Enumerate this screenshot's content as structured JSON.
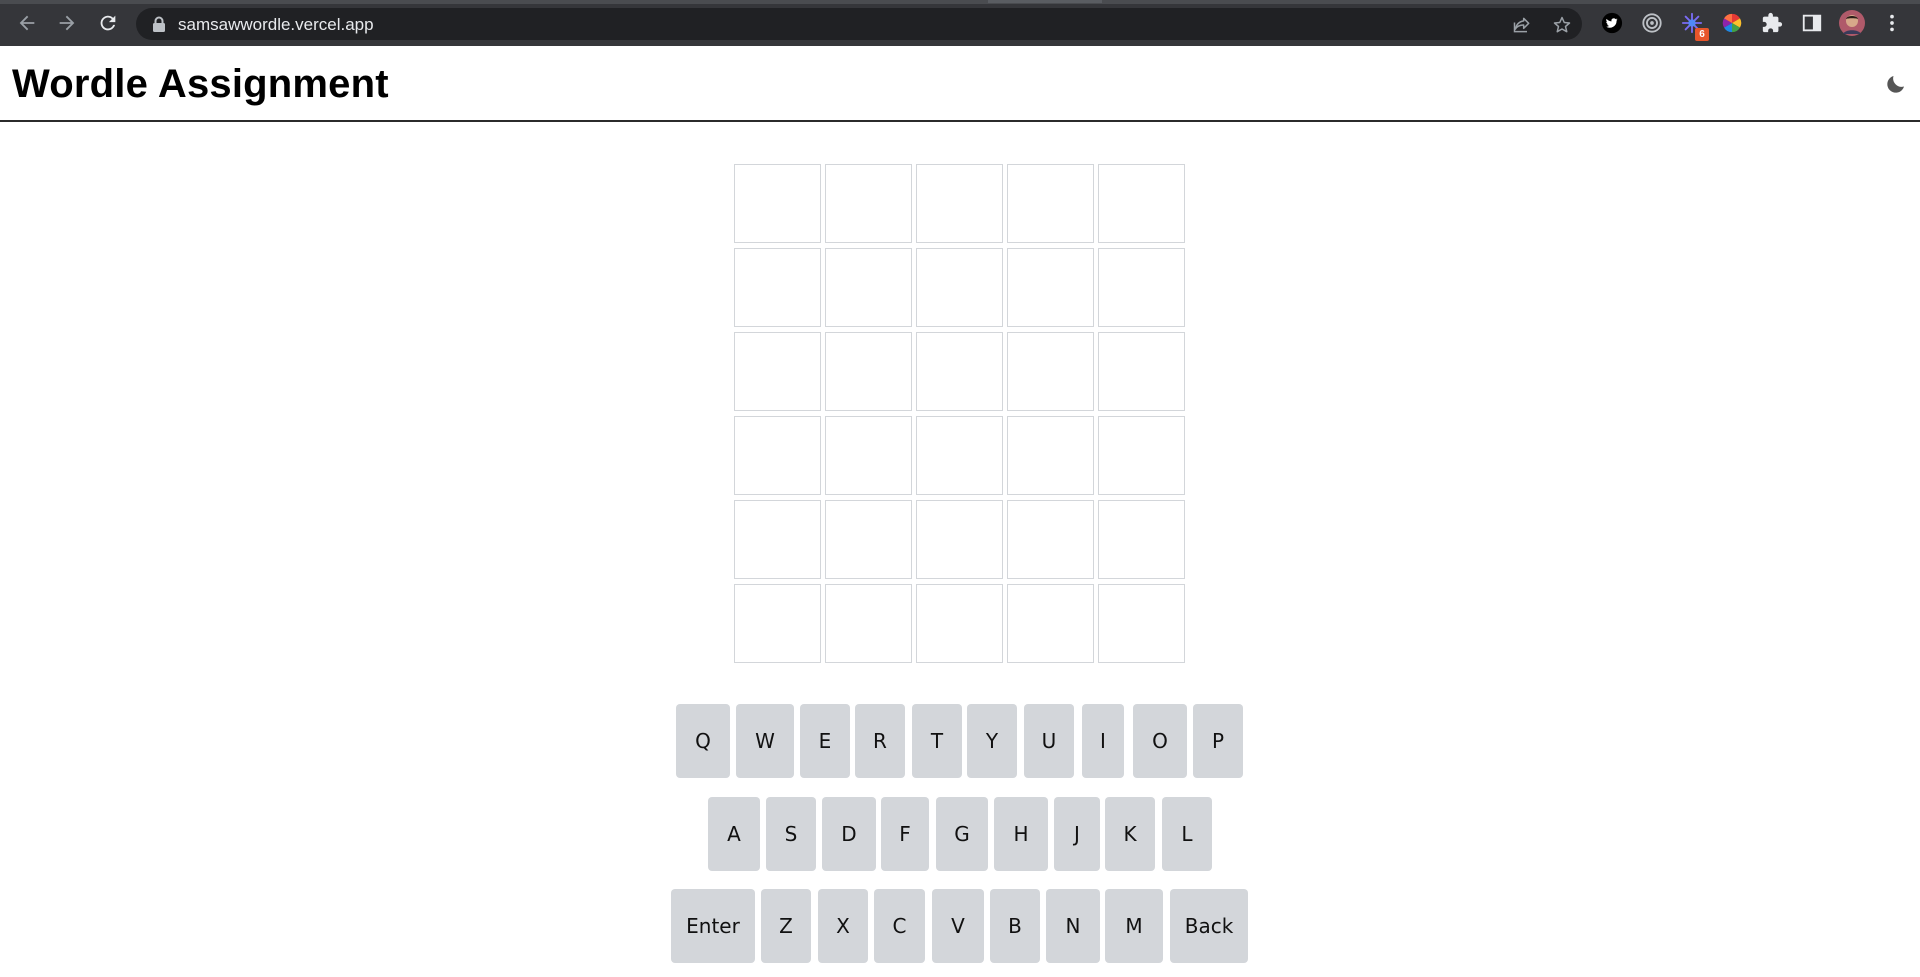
{
  "browser": {
    "url": "samsawwordle.vercel.app",
    "extension_badge": "6",
    "icons": {
      "back": "arrow-left-icon",
      "forward": "arrow-right-icon",
      "reload": "reload-icon",
      "lock": "lock-icon",
      "share": "share-icon",
      "bookmark": "star-icon",
      "twitter": "twitter-icon",
      "target": "target-icon",
      "extension_sparkle": "sparkle-extension-icon",
      "color_wheel": "color-wheel-icon",
      "extensions": "puzzle-icon",
      "side_panel": "side-panel-icon",
      "profile": "avatar",
      "menu": "kebab-menu-icon"
    }
  },
  "header": {
    "title": "Wordle Assignment",
    "theme_icon": "moon-icon"
  },
  "board": {
    "rows": [
      [
        "",
        "",
        "",
        "",
        ""
      ],
      [
        "",
        "",
        "",
        "",
        ""
      ],
      [
        "",
        "",
        "",
        "",
        ""
      ],
      [
        "",
        "",
        "",
        "",
        ""
      ],
      [
        "",
        "",
        "",
        "",
        ""
      ],
      [
        "",
        "",
        "",
        "",
        ""
      ]
    ]
  },
  "keyboard": {
    "row1": [
      "Q",
      "W",
      "E",
      "R",
      "T",
      "Y",
      "U",
      "I",
      "O",
      "P"
    ],
    "row2": [
      "A",
      "S",
      "D",
      "F",
      "G",
      "H",
      "J",
      "K",
      "L"
    ],
    "row3": [
      "Enter",
      "Z",
      "X",
      "C",
      "V",
      "B",
      "N",
      "M",
      "Back"
    ]
  },
  "colors": {
    "chrome_bg": "#35363a",
    "omnibox_bg": "#202124",
    "key_bg": "#d3d6da",
    "tile_border": "#d3d6da",
    "header_border": "#2b2b2b"
  }
}
